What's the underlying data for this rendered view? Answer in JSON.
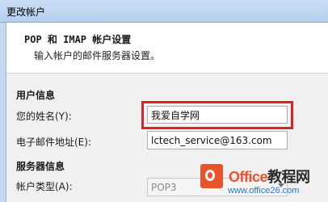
{
  "window": {
    "title": "更改帐户"
  },
  "header": {
    "title": "POP 和 IMAP 帐户设置",
    "description": "输入帐户的邮件服务器设置。"
  },
  "user_info": {
    "section_title": "用户信息",
    "name_label": "您的姓名(Y):",
    "name_value": "我爱自学网",
    "email_label": "电子邮件地址(E):",
    "email_value": "lctech_service@163.com"
  },
  "server_info": {
    "section_title": "服务器信息",
    "account_type_label": "帐户类型(A):",
    "account_type_value": "POP3"
  },
  "watermark": {
    "brand_en": "Office",
    "brand_cn": "教程网",
    "url": "www.office26.com"
  },
  "colors": {
    "highlight_border": "#d9222a",
    "watermark_orange": "#e8542a",
    "watermark_blue": "#2a78c6"
  }
}
